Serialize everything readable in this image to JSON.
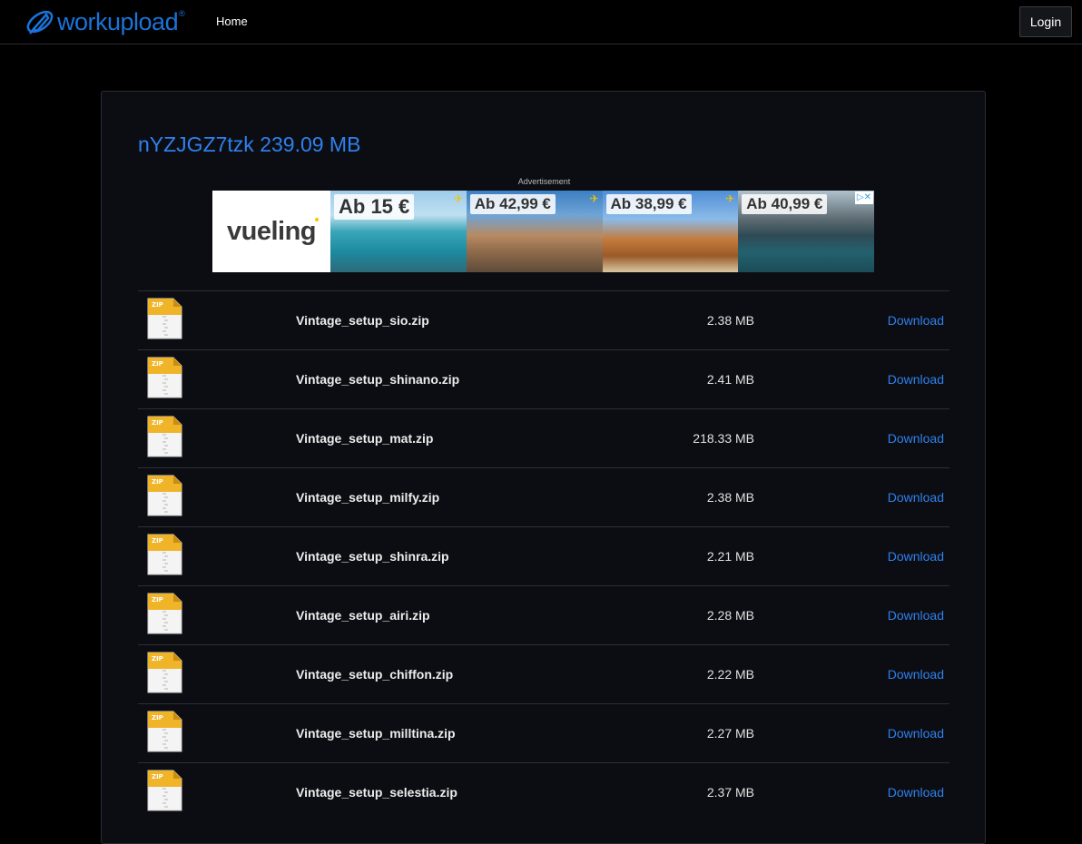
{
  "nav": {
    "logo_text": "workupload",
    "logo_reg": "®",
    "home": "Home",
    "login": "Login"
  },
  "page": {
    "title": "nYZJGZ7tzk 239.09 MB"
  },
  "ad": {
    "label": "Advertisement",
    "brand": "vueling",
    "adchoice": "▷✕",
    "tiles": [
      {
        "price": "Ab 15 €"
      },
      {
        "price": "Ab 42,99 €"
      },
      {
        "price": "Ab 38,99 €"
      },
      {
        "price": "Ab 40,99 €"
      }
    ]
  },
  "files": [
    {
      "name": "Vintage_setup_sio.zip",
      "size": "2.38 MB",
      "action": "Download",
      "icon_label": "ZIP"
    },
    {
      "name": "Vintage_setup_shinano.zip",
      "size": "2.41 MB",
      "action": "Download",
      "icon_label": "ZIP"
    },
    {
      "name": "Vintage_setup_mat.zip",
      "size": "218.33 MB",
      "action": "Download",
      "icon_label": "ZIP"
    },
    {
      "name": "Vintage_setup_milfy.zip",
      "size": "2.38 MB",
      "action": "Download",
      "icon_label": "ZIP"
    },
    {
      "name": "Vintage_setup_shinra.zip",
      "size": "2.21 MB",
      "action": "Download",
      "icon_label": "ZIP"
    },
    {
      "name": "Vintage_setup_airi.zip",
      "size": "2.28 MB",
      "action": "Download",
      "icon_label": "ZIP"
    },
    {
      "name": "Vintage_setup_chiffon.zip",
      "size": "2.22 MB",
      "action": "Download",
      "icon_label": "ZIP"
    },
    {
      "name": "Vintage_setup_milltina.zip",
      "size": "2.27 MB",
      "action": "Download",
      "icon_label": "ZIP"
    },
    {
      "name": "Vintage_setup_selestia.zip",
      "size": "2.37 MB",
      "action": "Download",
      "icon_label": "ZIP"
    }
  ],
  "colors": {
    "accent": "#2f80ed",
    "background": "#000000",
    "card": "#0c0d12"
  }
}
